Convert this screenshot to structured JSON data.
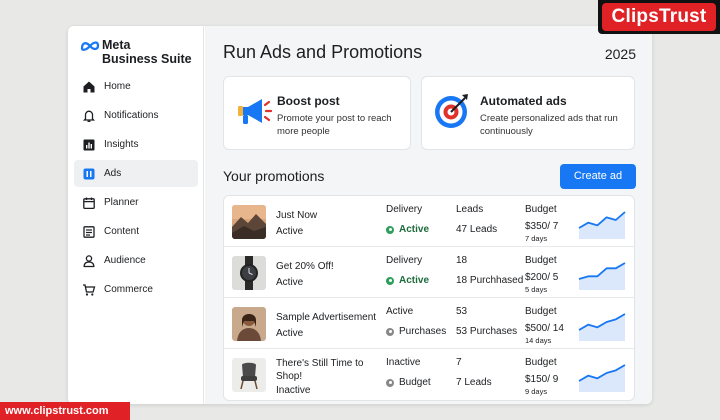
{
  "brand": {
    "line1": "Meta",
    "line2": "Business Suite"
  },
  "nav": [
    {
      "label": "Home",
      "icon": "home-icon",
      "active": false
    },
    {
      "label": "Notifications",
      "icon": "bell-icon",
      "active": false
    },
    {
      "label": "Insights",
      "icon": "bar-chart-icon",
      "active": false
    },
    {
      "label": "Ads",
      "icon": "ads-icon",
      "active": true
    },
    {
      "label": "Planner",
      "icon": "calendar-icon",
      "active": false
    },
    {
      "label": "Content",
      "icon": "content-icon",
      "active": false
    },
    {
      "label": "Audience",
      "icon": "person-icon",
      "active": false
    },
    {
      "label": "Commerce",
      "icon": "cart-icon",
      "active": false
    }
  ],
  "header": {
    "title": "Run Ads and Promotions",
    "year": "2025"
  },
  "cards": [
    {
      "title": "Boost post",
      "desc": "Promote your post to reach more people",
      "icon": "megaphone-icon"
    },
    {
      "title": "Automated ads",
      "desc": "Create personalized ads that run continuously",
      "icon": "target-icon"
    }
  ],
  "promotions": {
    "title": "Your promotions",
    "create_label": "Create ad",
    "colors": {
      "accent": "#1877f2",
      "active": "#2e9e5b",
      "inactive": "#888888"
    },
    "rows": [
      {
        "name": "Just Now",
        "status": "Active",
        "delivery_head": "Delivery",
        "delivery_value": "Active",
        "delivery_dot": "green",
        "leads_head": "Leads",
        "leads_value": "47 Leads",
        "budget_head": "Budget",
        "budget_value": "$350/ 7",
        "budget_days": "7 days",
        "trend": [
          3,
          5,
          4,
          7,
          6,
          9
        ]
      },
      {
        "name": "Get 20% Off!",
        "status": "Active",
        "delivery_head": "Delivery",
        "delivery_value": "Active",
        "delivery_dot": "green",
        "leads_head": "18",
        "leads_value": "18 Purchhased",
        "budget_head": "Budget",
        "budget_value": "$200/ 5",
        "budget_days": "5 days",
        "trend": [
          3,
          4,
          4,
          7,
          7,
          9
        ]
      },
      {
        "name": "Sample Advertisement",
        "status": "Active",
        "delivery_head": "Active",
        "delivery_value": "Purchases",
        "delivery_dot": "grey",
        "leads_head": "53",
        "leads_value": "53  Purchases",
        "budget_head": "Budget",
        "budget_value": "$500/ 14",
        "budget_days": "14 days",
        "trend": [
          3,
          5,
          4,
          6,
          7,
          9
        ]
      },
      {
        "name": "There's Still Time to Shop!",
        "status": "Inactive",
        "delivery_head": "Inactive",
        "delivery_value": "Budget",
        "delivery_dot": "grey",
        "leads_head": "7",
        "leads_value": "7  Leads",
        "budget_head": "Budget",
        "budget_value": "$150/ 9",
        "budget_days": "9 days",
        "trend": [
          3,
          5,
          4,
          6,
          7,
          9
        ]
      }
    ]
  },
  "watermark": {
    "top": "ClipsTrust",
    "bottom": "www.clipstrust.com"
  }
}
